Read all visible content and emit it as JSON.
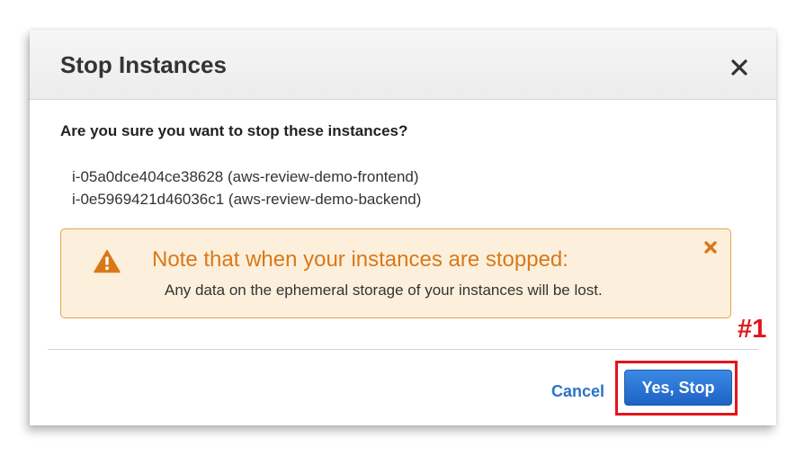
{
  "dialog": {
    "title": "Stop Instances",
    "close_icon": "close-icon",
    "question": "Are you sure you want to stop these instances?",
    "instances": [
      "i-05a0dce404ce38628 (aws-review-demo-frontend)",
      "i-0e5969421d46036c1 (aws-review-demo-backend)"
    ]
  },
  "warning": {
    "icon": "warning-triangle-icon",
    "dismiss_icon": "dismiss-x-icon",
    "title": "Note that when your instances are stopped:",
    "text": "Any data on the ephemeral storage of your instances will be lost.",
    "accent_color": "#d9781a",
    "background_color": "#fcf0dc"
  },
  "footer": {
    "cancel_label": "Cancel",
    "confirm_label": "Yes, Stop",
    "primary_color": "#1d62c4"
  },
  "annotation": {
    "step_label": "#1",
    "color": "#e2151c"
  }
}
